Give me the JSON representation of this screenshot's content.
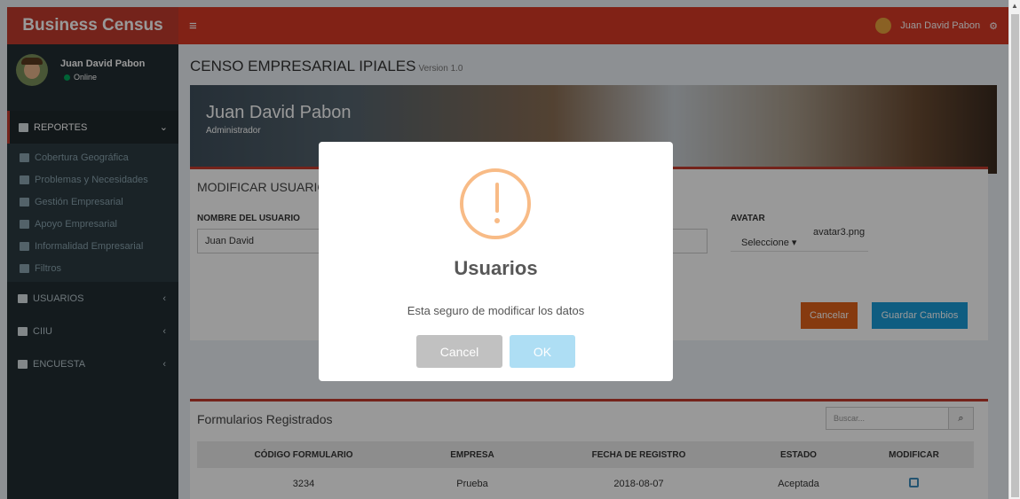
{
  "sidebar": {
    "brand": "Business Census",
    "user_name": "Juan David Pabon",
    "user_status": "Online",
    "reportes_label": "REPORTES",
    "report_items": [
      {
        "label": "Cobertura Geográfica",
        "icon": "map-icon"
      },
      {
        "label": "Problemas y Necesidades",
        "icon": "edit-icon"
      },
      {
        "label": "Gestión Empresarial",
        "icon": "table-icon"
      },
      {
        "label": "Apoyo Empresarial",
        "icon": "briefcase-icon"
      },
      {
        "label": "Informalidad Empresarial",
        "icon": "file-icon"
      },
      {
        "label": "Filtros",
        "icon": "filter-icon"
      }
    ],
    "nav_items": [
      {
        "label": "USUARIOS",
        "icon": "users-icon"
      },
      {
        "label": "CIIU",
        "icon": "file-icon"
      },
      {
        "label": "ENCUESTA",
        "icon": "file-text-icon"
      }
    ]
  },
  "topbar": {
    "menu_glyph": "≡",
    "user_name": "Juan David Pabon"
  },
  "page": {
    "title": "CENSO EMPRESARIAL IPIALES",
    "version": "Version 1.0"
  },
  "profile": {
    "name": "Juan David Pabon",
    "role": "Administrador"
  },
  "form": {
    "title": "MODIFICAR USUARIO",
    "name_label": "NOMBRE DEL USUARIO",
    "name_value": "Juan David",
    "avatar_label": "AVATAR",
    "select_label": "Seleccione",
    "avatar_file": "avatar3.png",
    "cancel_label": "Cancelar",
    "save_label": "Guardar Cambios"
  },
  "table": {
    "title": "Formularios Registrados",
    "search_placeholder": "Buscar...",
    "headers": [
      "CÓDIGO FORMULARIO",
      "EMPRESA",
      "FECHA DE REGISTRO",
      "ESTADO",
      "MODIFICAR"
    ],
    "rows": [
      {
        "codigo": "3234",
        "empresa": "Prueba",
        "fecha": "2018-08-07",
        "estado": "Aceptada"
      }
    ]
  },
  "modal": {
    "title": "Usuarios",
    "text": "Esta seguro de modificar los datos",
    "cancel_label": "Cancel",
    "ok_label": "OK"
  },
  "colors": {
    "brand": "#c23b2e",
    "topbar": "#d73925",
    "sidebar": "#222d32",
    "warning": "#f8bb86",
    "ok_button": "#aedef4",
    "save_button": "#1a9bd7",
    "cancel_button": "#e0621a"
  }
}
